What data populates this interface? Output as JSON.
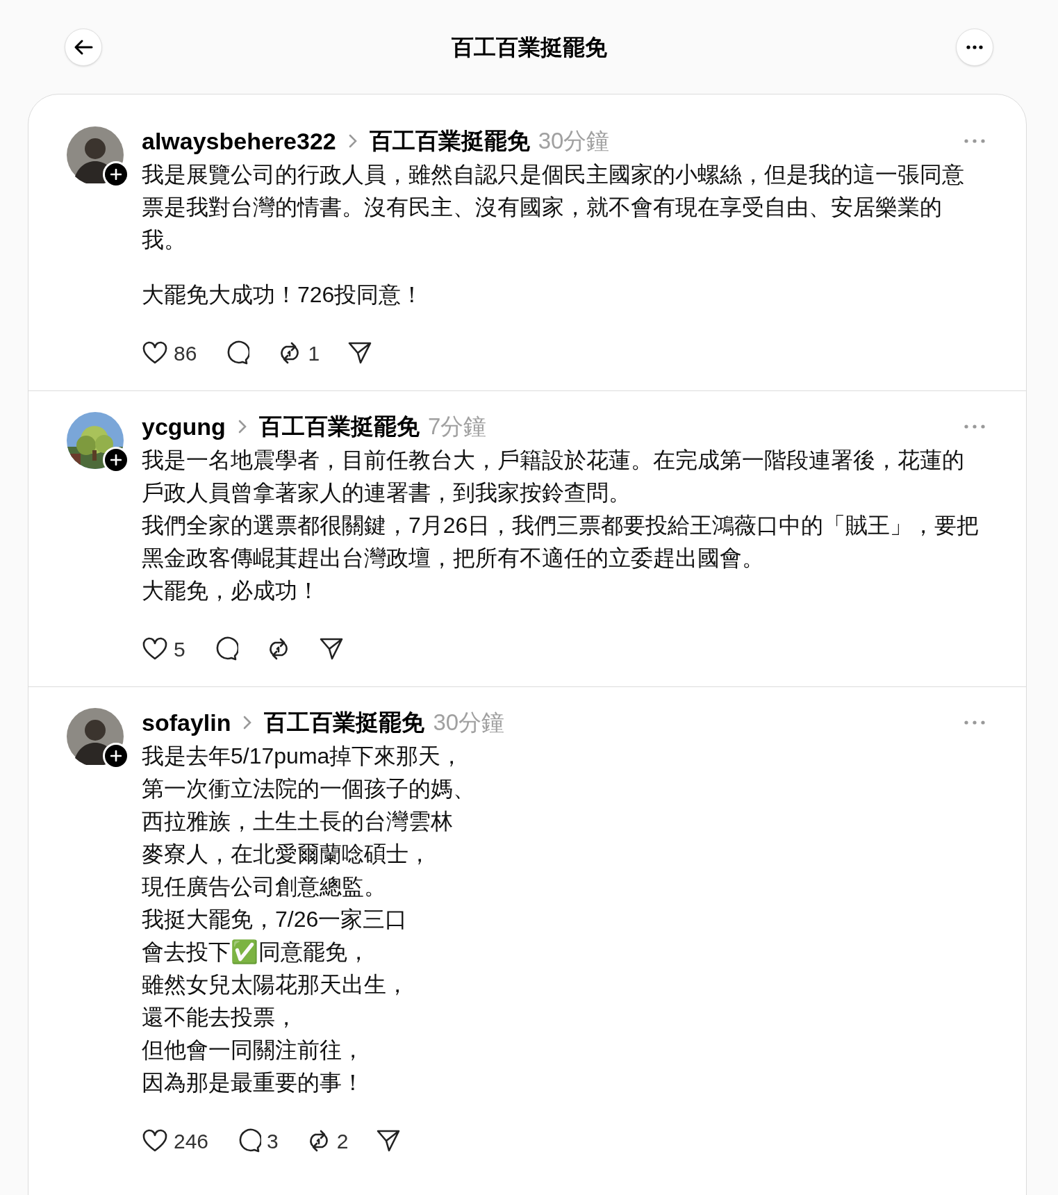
{
  "header": {
    "title": "百工百業挺罷免"
  },
  "posts": [
    {
      "username": "alwaysbehere322",
      "community": "百工百業挺罷免",
      "time": "30分鐘",
      "avatar": {
        "kind": "person"
      },
      "paragraphs": [
        [
          "我是展覽公司的行政人員，雖然自認只是個民主國家的小螺絲，但是我的這一張同意票是我對台灣的情書。沒有民主、沒有國家，就不會有現在享受自由、安居樂業的我。"
        ],
        [
          "大罷免大成功！726投同意！"
        ]
      ],
      "likes": "86",
      "reposts": "1"
    },
    {
      "username": "ycgung",
      "community": "百工百業挺罷免",
      "time": "7分鐘",
      "avatar": {
        "kind": "picture"
      },
      "paragraphs": [
        [
          "我是一名地震學者，目前任教台大，戶籍設於花蓮。在完成第一階段連署後，花蓮的戶政人員曾拿著家人的連署書，到我家按鈴查問。",
          "我們全家的選票都很關鍵，7月26日，我們三票都要投給王鴻薇口中的「賊王」，要把黑金政客傳崐萁趕出台灣政壇，把所有不適任的立委趕出國會。",
          "大罷免，必成功！"
        ]
      ],
      "likes": "5"
    },
    {
      "username": "sofaylin",
      "community": "百工百業挺罷免",
      "time": "30分鐘",
      "avatar": {
        "kind": "person"
      },
      "paragraphs": [
        [
          "我是去年5/17puma掉下來那天，",
          "第一次衝立法院的一個孩子的媽、",
          "西拉雅族，土生土長的台灣雲林",
          "麥寮人，在北愛爾蘭唸碩士，",
          "現任廣告公司創意總監。",
          "我挺大罷免，7/26一家三口",
          "會去投下✅同意罷免，",
          "雖然女兒太陽花那天出生，",
          "還不能去投票，",
          "但他會一同關注前往，",
          "因為那是最重要的事！"
        ]
      ],
      "likes": "246",
      "replies": "3",
      "reposts": "2"
    }
  ]
}
